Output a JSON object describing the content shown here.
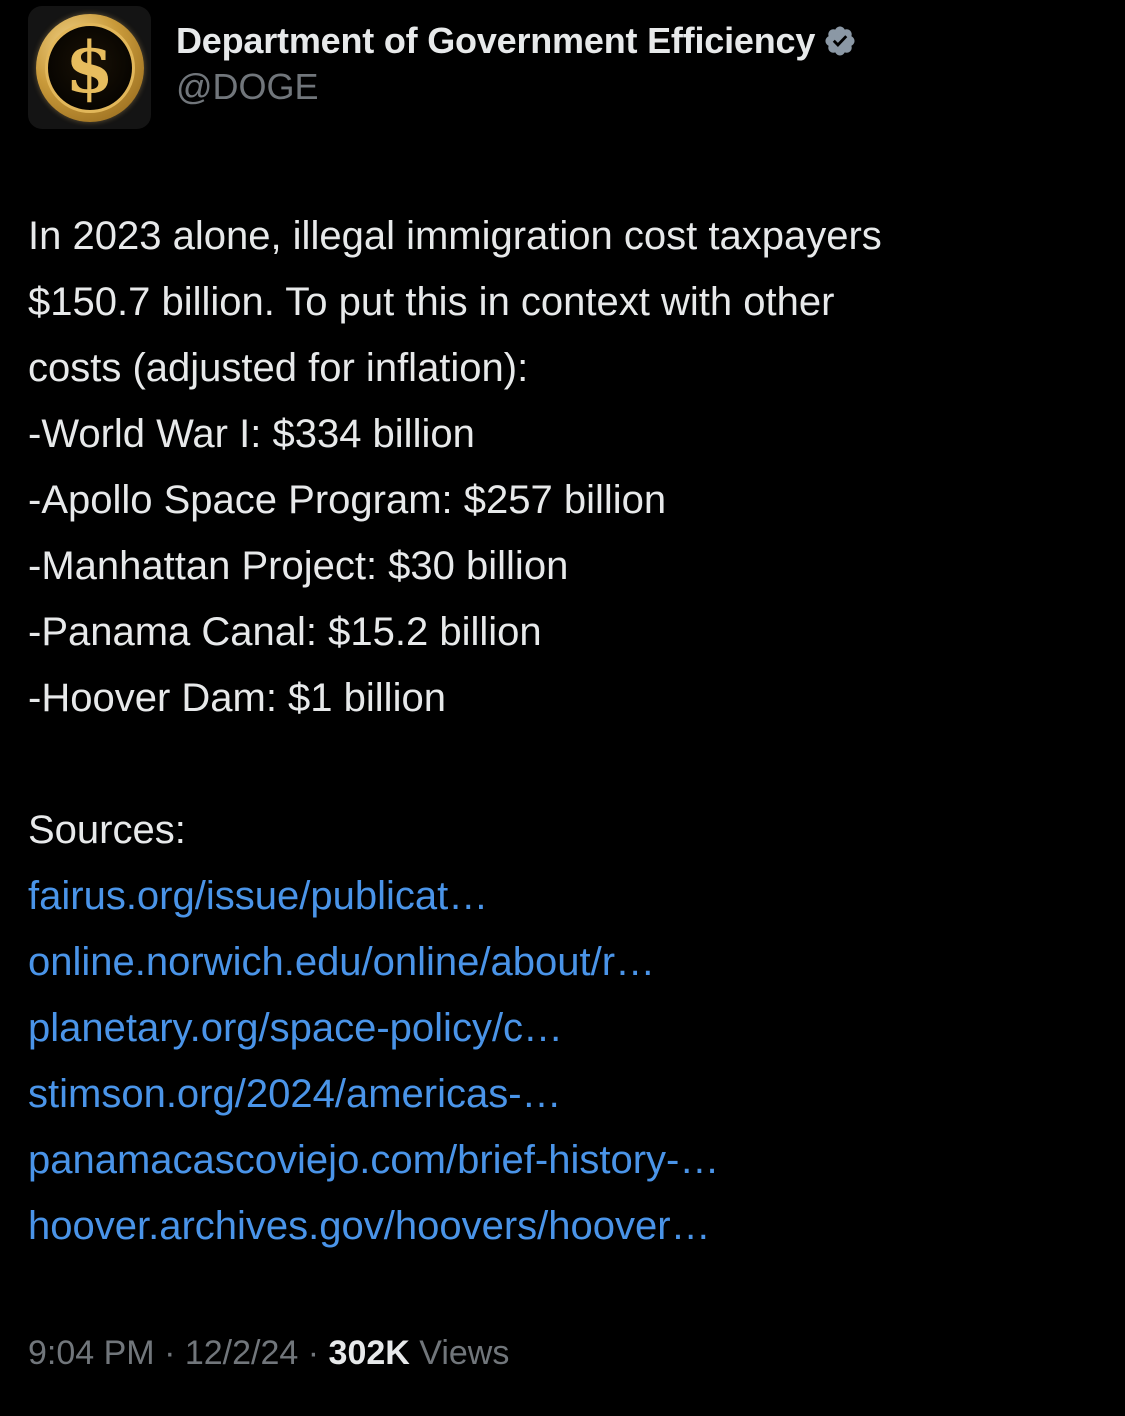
{
  "author": {
    "display_name": "Department of Government Efficiency",
    "handle": "@DOGE",
    "avatar_icon": "gold-dollar-coin-icon",
    "avatar_symbol": "$",
    "verified_icon": "verified-badge-icon",
    "verified_color": "#8b98a5"
  },
  "post": {
    "lines": [
      "In 2023 alone, illegal immigration cost taxpayers",
      "$150.7 billion.  To put this in context with other",
      "costs (adjusted for inflation):",
      "-World War I: $334 billion",
      "-Apollo Space Program: $257 billion",
      "-Manhattan Project: $30 billion",
      "-Panama Canal: $15.2 billion",
      "-Hoover Dam: $1 billion"
    ],
    "sources_label": "Sources:",
    "links": [
      "fairus.org/issue/publicat…",
      "online.norwich.edu/online/about/r…",
      "planetary.org/space-policy/c…",
      "stimson.org/2024/americas-…",
      "panamacascoviejo.com/brief-history-…",
      "hoover.archives.gov/hoovers/hoover…"
    ],
    "link_color": "#4a94e8"
  },
  "meta": {
    "time": "9:04 PM",
    "separator": "·",
    "date": "12/2/24",
    "views_count": "302K",
    "views_label": "Views"
  }
}
